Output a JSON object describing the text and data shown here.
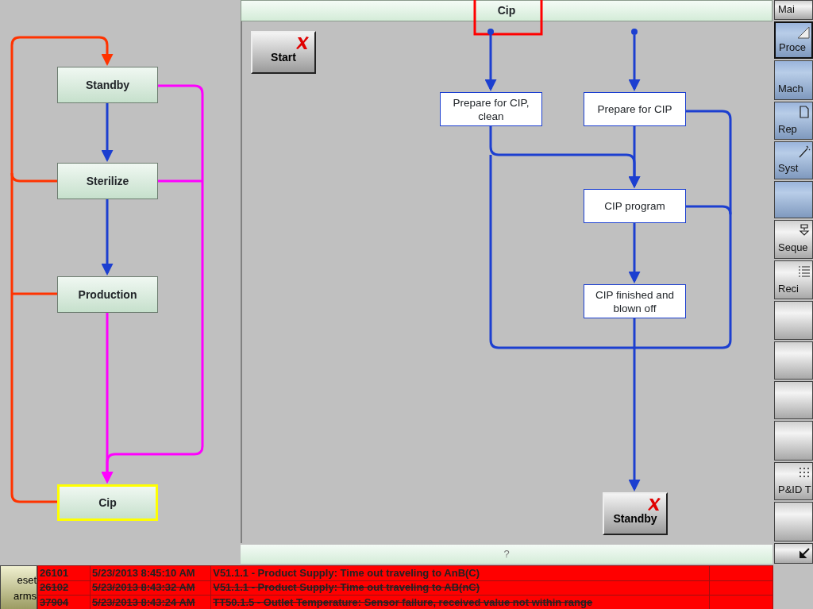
{
  "window": {
    "title": "Cip"
  },
  "state_diagram": {
    "nodes": [
      {
        "label": "Standby",
        "selected": false
      },
      {
        "label": "Sterilize",
        "selected": false
      },
      {
        "label": "Production",
        "selected": false
      },
      {
        "label": "Cip",
        "selected": true
      }
    ]
  },
  "sequence": {
    "start_button": "Start",
    "steps": [
      {
        "label": "Prepare for CIP, clean"
      },
      {
        "label": "Prepare for CIP"
      },
      {
        "label": "CIP program"
      },
      {
        "label": "CIP finished and blown off"
      }
    ],
    "next_button": "Standby"
  },
  "footer": {
    "text": "?"
  },
  "nav": [
    {
      "label": "Mai",
      "kind": "plain",
      "selected": false
    },
    {
      "label": "Proce",
      "kind": "primary",
      "selected": true
    },
    {
      "label": "Mach",
      "kind": "primary",
      "selected": false
    },
    {
      "label": "Rep",
      "kind": "primary",
      "selected": false
    },
    {
      "label": "Syst",
      "kind": "primary",
      "selected": false
    },
    {
      "kind": "primary",
      "selected": false
    },
    {
      "label": "Seque",
      "kind": "plain",
      "selected": false
    },
    {
      "label": "Reci",
      "kind": "plain",
      "selected": false
    },
    {
      "kind": "plain",
      "selected": false
    },
    {
      "kind": "plain",
      "selected": false
    },
    {
      "kind": "plain",
      "selected": false
    },
    {
      "kind": "plain",
      "selected": false
    },
    {
      "label": "P&ID T",
      "kind": "plain",
      "selected": false
    },
    {
      "kind": "plain",
      "selected": false
    },
    {
      "kind": "plain",
      "selected": false
    }
  ],
  "alarms": {
    "reset_button": "eset arms",
    "rows": [
      {
        "id": "26101",
        "time": "5/23/2013 8:45:10 AM",
        "message": "V51.1.1 - Product Supply: Time out traveling to AnB(C)",
        "struck": false
      },
      {
        "id": "26102",
        "time": "5/23/2013 8:43:32 AM",
        "message": "V51.1.1 - Product Supply: Time out traveling to AB(nC)",
        "struck": true
      },
      {
        "id": "37904",
        "time": "5/23/2013 8:43:24 AM",
        "message": "TT50.1.5 - Outlet Temperature: Sensor failure, received value not within range",
        "struck": true
      }
    ]
  }
}
